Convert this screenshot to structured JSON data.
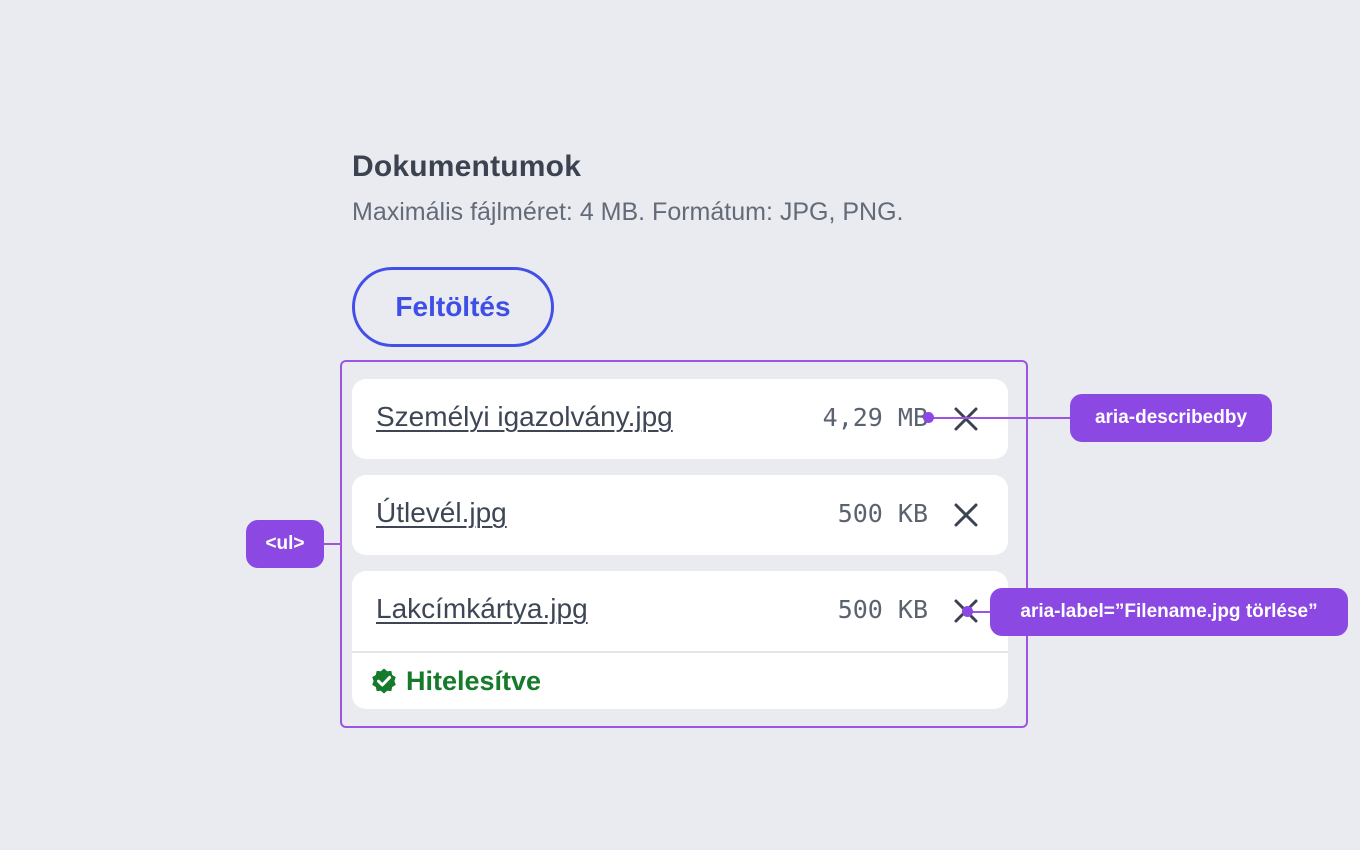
{
  "section": {
    "title": "Dokumentumok",
    "subtitle": "Maximális fájlméret: 4 MB. Formátum: JPG, PNG."
  },
  "upload_button": {
    "label": "Feltöltés"
  },
  "files": [
    {
      "name": "Személyi igazolvány.jpg",
      "size": "4,29 MB",
      "remove_icon": "close-icon"
    },
    {
      "name": "Útlevél.jpg",
      "size": "500 KB",
      "remove_icon": "close-icon"
    },
    {
      "name": "Lakcímkártya.jpg",
      "size": "500 KB",
      "remove_icon": "close-icon",
      "status": "Hitelesítve",
      "status_icon": "verified-badge-icon"
    }
  ],
  "annotations": {
    "list_tag": "<ul>",
    "describedby": "aria-describedby",
    "label": "aria-label=”Filename.jpg törlése”"
  },
  "colors": {
    "background": "#e9ebf0",
    "accent": "#4350e8",
    "annotation": "#8b48e3",
    "success": "#167a2b"
  }
}
